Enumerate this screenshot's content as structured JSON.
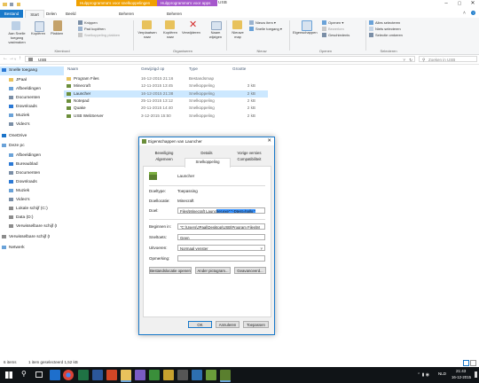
{
  "window": {
    "title": "USB",
    "context_tabs": [
      "Hulpprogramma's voor snelkoppelingen",
      "Hulpprogramma's voor apps"
    ],
    "context_tab_colors": [
      "#f0a000",
      "#a657cc"
    ]
  },
  "ribbon_tabs": [
    "Bestand",
    "Start",
    "Delen",
    "Beeld",
    "Beheren",
    "Beheren"
  ],
  "ribbon": {
    "group_klembord": {
      "label": "Klembord",
      "pin": "Aan Snelle toegang vastmaken",
      "copy": "Kopiëren",
      "paste": "Plakken",
      "cut": "Knippen",
      "copy_path": "Pad kopiëren",
      "paste_shortcut": "Snelkoppeling plakken"
    },
    "group_organiseren": {
      "label": "Organiseren",
      "move_to": "Verplaatsen naar",
      "copy_to": "Kopiëren naar",
      "delete": "Verwijderen",
      "rename": "Naam wijzigen"
    },
    "group_nieuw": {
      "label": "Nieuw",
      "new_folder": "Nieuwe map",
      "new_item": "Nieuw item",
      "easy_access": "Snelle toegang"
    },
    "group_openen": {
      "label": "Openen",
      "properties": "Eigenschappen",
      "open": "Openen",
      "edit": "Bewerken",
      "history": "Geschiedenis"
    },
    "group_selecteren": {
      "label": "Selecteren",
      "select_all": "Alles selecteren",
      "select_none": "Niets selecteren",
      "invert": "Selectie omkeren"
    }
  },
  "address": {
    "path": "USB",
    "search_placeholder": "Zoeken in USB"
  },
  "nav": {
    "items": [
      {
        "label": "Snelle toegang",
        "icon": "star-icon",
        "color": "#2b79d5"
      },
      {
        "label": "JPaal",
        "icon": "folder-icon",
        "color": "#e8c25c"
      },
      {
        "label": "Afbeeldingen",
        "icon": "pictures-icon",
        "color": "#6aa2d8"
      },
      {
        "label": "Documenten",
        "icon": "documents-icon",
        "color": "#7a8ea6"
      },
      {
        "label": "Downloads",
        "icon": "download-icon",
        "color": "#2b79d5"
      },
      {
        "label": "Muziek",
        "icon": "music-icon",
        "color": "#6aa2d8"
      },
      {
        "label": "Video's",
        "icon": "video-icon",
        "color": "#7a8ea6"
      },
      {
        "label": "OneDrive",
        "icon": "cloud-icon",
        "color": "#1a73c9"
      },
      {
        "label": "Deze pc",
        "icon": "computer-icon",
        "color": "#6aa2d8"
      },
      {
        "label": "Afbeeldingen",
        "icon": "pictures-icon",
        "color": "#6aa2d8"
      },
      {
        "label": "Bureaublad",
        "icon": "desktop-icon",
        "color": "#2b79d5"
      },
      {
        "label": "Documenten",
        "icon": "documents-icon",
        "color": "#7a8ea6"
      },
      {
        "label": "Downloads",
        "icon": "download-icon",
        "color": "#2b79d5"
      },
      {
        "label": "Muziek",
        "icon": "music-icon",
        "color": "#6aa2d8"
      },
      {
        "label": "Video's",
        "icon": "video-icon",
        "color": "#7a8ea6"
      },
      {
        "label": "Lokale schijf (C:)",
        "icon": "drive-icon",
        "color": "#8c8c8c"
      },
      {
        "label": "Data (D:)",
        "icon": "drive-icon",
        "color": "#8c8c8c"
      },
      {
        "label": "Verwisselbare schijf (I",
        "icon": "usb-drive-icon",
        "color": "#8c8c8c"
      },
      {
        "label": "Verwisselbare schijf (I",
        "icon": "usb-drive-icon",
        "color": "#8c8c8c"
      },
      {
        "label": "Netwerk",
        "icon": "network-icon",
        "color": "#6aa2d8"
      }
    ]
  },
  "files": {
    "columns": [
      "Naam",
      "Gewijzigd op",
      "Type",
      "Grootte"
    ],
    "rows": [
      {
        "name": "Program Files",
        "date": "16-12-2015 21:16",
        "type": "Bestandsmap",
        "size": "",
        "icon": "folder-icon"
      },
      {
        "name": "Minecraft",
        "date": "12-11-2015 13:45",
        "type": "Snelkoppeling",
        "size": "3 kB",
        "icon": "shortcut-icon"
      },
      {
        "name": "Launcher",
        "date": "16-12-2015 21:38",
        "type": "Snelkoppeling",
        "size": "2 kB",
        "icon": "shortcut-icon"
      },
      {
        "name": "Notepad",
        "date": "25-11-2015 13:12",
        "type": "Snelkoppeling",
        "size": "2 kB",
        "icon": "shortcut-icon"
      },
      {
        "name": "Quake",
        "date": "20-11-2015 14:40",
        "type": "Snelkoppeling",
        "size": "2 kB",
        "icon": "shortcut-icon"
      },
      {
        "name": "USB WebServer",
        "date": "3-12-2015 15:50",
        "type": "Snelkoppeling",
        "size": "2 kB",
        "icon": "shortcut-icon"
      }
    ],
    "selected_index": 2
  },
  "status": {
    "count": "6 items",
    "selection": "1 item geselecteerd  1,52 kB"
  },
  "dialog": {
    "title": "Eigenschappen van Launcher",
    "tabs_row1": [
      "Beveiliging",
      "Details",
      "Vorige versies"
    ],
    "tabs_row2": [
      "Algemeen",
      "Snelkoppeling",
      "Compatibiliteit"
    ],
    "active_tab": "Snelkoppeling",
    "name": "Launcher",
    "fields": {
      "doeltype_label": "Doeltype:",
      "doeltype_value": "Toepassing",
      "doellocatie_label": "Doellocatie:",
      "doellocatie_value": "Minecraft",
      "doel_label": "Doel:",
      "doel_value": "Files\\Minecraft Launcher.exe\" \"-Dtest=hallo \"",
      "beginnen_label": "Beginnen in:",
      "beginnen_value": "\"C:\\Users\\JPaal\\Desktop\\USB\\Program Files\\M",
      "sneltoets_label": "Sneltoets:",
      "sneltoets_value": "Geen",
      "uitvoeren_label": "Uitvoeren:",
      "uitvoeren_value": "Normaal venster",
      "opmerking_label": "Opmerking:",
      "opmerking_value": ""
    },
    "buttons": {
      "open_location": "Bestandslocatie openen",
      "change_icon": "Ander pictogram...",
      "advanced": "Geavanceerd...",
      "ok": "OK",
      "cancel": "Annuleren",
      "apply": "Toepassen"
    }
  },
  "taskbar": {
    "lang": "NLD",
    "time": "21:43",
    "date": "16-12-2015"
  }
}
